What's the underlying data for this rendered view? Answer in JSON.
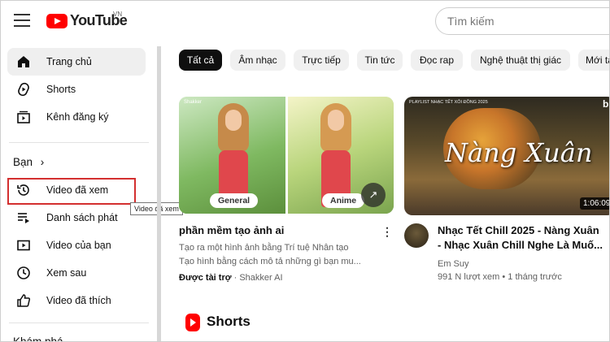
{
  "header": {
    "logo_text": "YouTube",
    "region": "VN",
    "search_placeholder": "Tìm kiếm"
  },
  "sidebar": {
    "items": [
      {
        "label": "Trang chủ",
        "icon": "home-icon"
      },
      {
        "label": "Shorts",
        "icon": "shorts-icon"
      },
      {
        "label": "Kênh đăng ký",
        "icon": "subscriptions-icon"
      }
    ],
    "you_section": "Bạn",
    "you_items": [
      {
        "label": "Video đã xem",
        "icon": "history-icon"
      },
      {
        "label": "Danh sách phát",
        "icon": "playlist-icon"
      },
      {
        "label": "Video của bạn",
        "icon": "your-videos-icon"
      },
      {
        "label": "Xem sau",
        "icon": "watch-later-icon"
      },
      {
        "label": "Video đã thích",
        "icon": "like-icon"
      }
    ],
    "explore_section": "Khám phá",
    "tooltip": "Video đã xem"
  },
  "chips": [
    "Tất cả",
    "Âm nhạc",
    "Trực tiếp",
    "Tin tức",
    "Đọc rap",
    "Nghệ thuật thị giác",
    "Mới tả"
  ],
  "videos": [
    {
      "title": "phần mềm tạo ảnh ai",
      "desc1": "Tạo ra một hình ảnh bằng Trí tuệ Nhân tạo",
      "desc2": "Tạo hình bằng cách mô tả những gì bạn mu...",
      "sponsor": "Được tài trợ",
      "channel": "· Shakker AI",
      "tag_left": "General",
      "tag_right": "Anime",
      "brand": "Shakker"
    },
    {
      "title_line1": "Nhạc Tết Chill 2025 - Nàng Xuân",
      "title_line2": "- Nhạc Xuân Chill Nghe Là Muố...",
      "channel": "Em Suy",
      "meta": "991 N lượt xem • 1 tháng trước",
      "duration": "1:06:09",
      "art_title": "Nàng Xuân",
      "art_top": "PLAYLIST NHẠC TẾT XÔI ĐỒNG 2025",
      "art_badge": "b"
    }
  ],
  "shorts_section": "Shorts"
}
